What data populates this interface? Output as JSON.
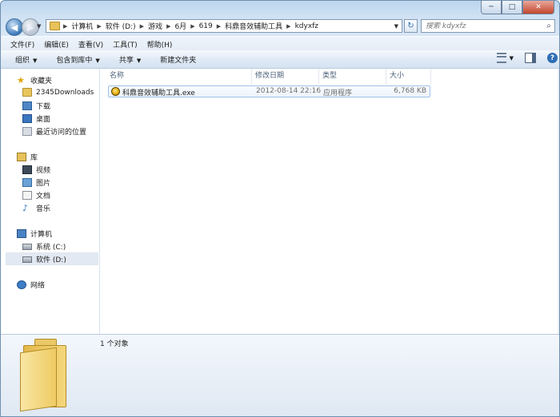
{
  "window": {
    "min_label": "─",
    "max_label": "□",
    "close_label": "✕"
  },
  "nav_buttons": {
    "back": "◀",
    "forward": "▶",
    "dropdown": "▼"
  },
  "address": {
    "segments": [
      "计算机",
      "软件 (D:)",
      "游戏",
      "6月",
      "619",
      "科鼎音效辅助工具",
      "kdyxfz"
    ],
    "dropdown": "▼"
  },
  "refresh": "↻",
  "search": {
    "placeholder": "搜索 kdyxfz"
  },
  "menu": [
    "文件(F)",
    "编辑(E)",
    "查看(V)",
    "工具(T)",
    "帮助(H)"
  ],
  "commands": {
    "organize": "组织",
    "include_in_library": "包含到库中",
    "share": "共享",
    "new_folder": "新建文件夹",
    "dropdown": "▼"
  },
  "sidebar": {
    "favorites": {
      "title": "收藏夹",
      "items": [
        "2345Downloads",
        "下载",
        "桌面",
        "最近访问的位置"
      ]
    },
    "libraries": {
      "title": "库",
      "items": [
        "视频",
        "图片",
        "文档",
        "音乐"
      ]
    },
    "computer": {
      "title": "计算机",
      "items": [
        "系统 (C:)",
        "软件 (D:)"
      ]
    },
    "network": {
      "title": "网络"
    }
  },
  "columns": {
    "name": "名称",
    "modified": "修改日期",
    "type": "类型",
    "size": "大小"
  },
  "files": [
    {
      "name": "科鼎音效辅助工具.exe",
      "modified": "2012-08-14 22:16",
      "type": "应用程序",
      "size": "6,768 KB"
    }
  ],
  "details": {
    "count": "1 个对象"
  },
  "icons": {
    "star": "★",
    "music": "♪"
  }
}
